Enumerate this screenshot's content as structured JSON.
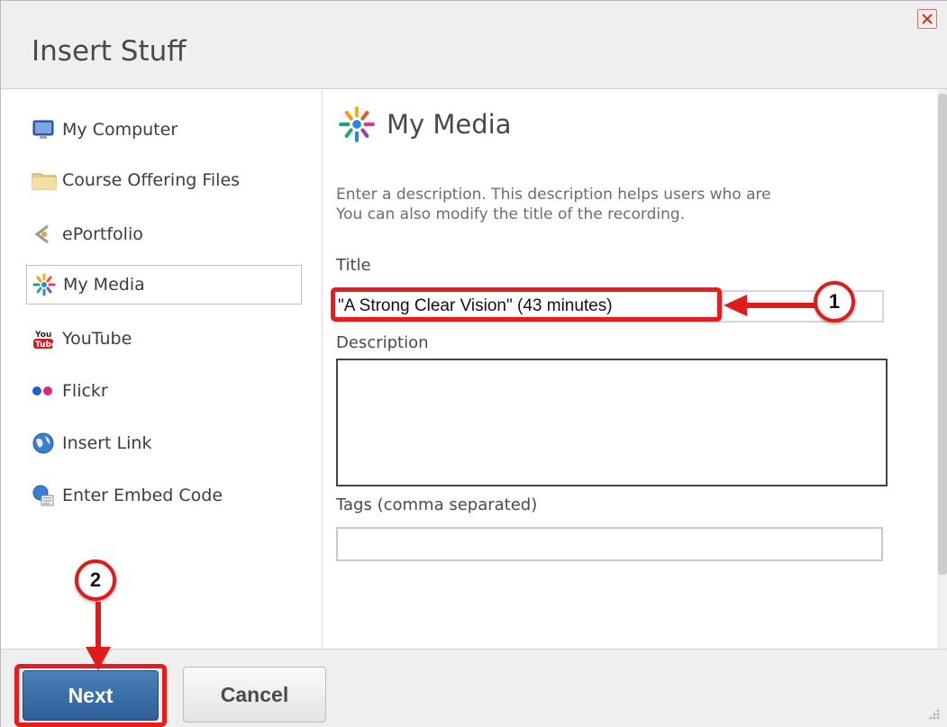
{
  "dialog": {
    "title": "Insert Stuff"
  },
  "sidebar": {
    "items": [
      {
        "label": "My Computer",
        "icon": "computer-icon"
      },
      {
        "label": "Course Offering Files",
        "icon": "folder-icon"
      },
      {
        "label": "ePortfolio",
        "icon": "eportfolio-icon"
      },
      {
        "label": "My Media",
        "icon": "my-media-icon",
        "selected": true
      },
      {
        "label": "YouTube",
        "icon": "youtube-icon"
      },
      {
        "label": "Flickr",
        "icon": "flickr-icon"
      },
      {
        "label": "Insert Link",
        "icon": "globe-icon"
      },
      {
        "label": "Enter Embed Code",
        "icon": "embed-code-icon"
      }
    ]
  },
  "main": {
    "heading": "My Media",
    "description_line1": "Enter a description. This description helps users who are",
    "description_line2": "You can also modify the title of the recording.",
    "title_label": "Title",
    "title_value": "\"A Strong Clear Vision\" (43 minutes)",
    "description_label": "Description",
    "description_value": "",
    "tags_label": "Tags (comma separated)",
    "tags_value": ""
  },
  "annotations": {
    "step1": "1",
    "step2": "2",
    "highlight_color": "#e41d1d"
  },
  "footer": {
    "next_label": "Next",
    "cancel_label": "Cancel"
  },
  "colors": {
    "primary_button": "#3a6da8",
    "header_bg": "#efefef"
  }
}
